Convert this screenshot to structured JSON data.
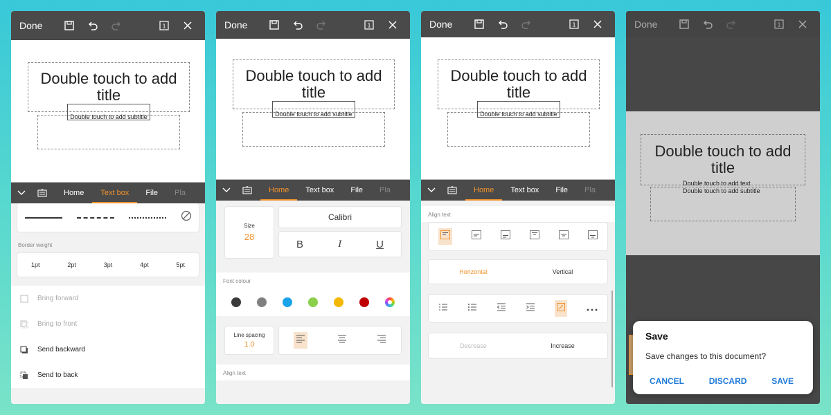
{
  "common": {
    "done_label": "Done",
    "slide_title": "Double touch to add title",
    "slide_subtitle": "Double touch to add subtitle"
  },
  "tabs": [
    "Home",
    "Text box",
    "File",
    "Pla"
  ],
  "panel1": {
    "border_weight_label": "Border weight",
    "weights": [
      "1pt",
      "2pt",
      "3pt",
      "4pt",
      "5pt"
    ],
    "arrange": [
      {
        "label": "Bring forward",
        "enabled": false
      },
      {
        "label": "Bring to front",
        "enabled": false
      },
      {
        "label": "Send backward",
        "enabled": true
      },
      {
        "label": "Send to back",
        "enabled": true
      }
    ]
  },
  "panel2": {
    "size_label": "Size",
    "size_value": "28",
    "font_name": "Calibri",
    "bold": "B",
    "italic": "I",
    "underline": "U",
    "font_colour_label": "Font colour",
    "colours": [
      "#3a3a3a",
      "#808080",
      "#1aa3e8",
      "#8bcf4a",
      "#f5b800",
      "#c00000"
    ],
    "line_spacing_label": "Line spacing",
    "line_spacing_value": "1.0",
    "align_text_label": "Align text"
  },
  "panel3": {
    "align_text_label": "Align text",
    "horizontal_label": "Horizontal",
    "vertical_label": "Vertical",
    "decrease_label": "Decrease",
    "increase_label": "Increase"
  },
  "panel4": {
    "overlay_text": "Double touch to add text",
    "dialog": {
      "title": "Save",
      "message": "Save changes to this document?",
      "cancel": "CANCEL",
      "discard": "DISCARD",
      "save": "SAVE"
    }
  },
  "colors": {
    "accent": "#f0922b",
    "toolbar": "#4a4a4a",
    "dialog_button": "#1f7ad8"
  }
}
